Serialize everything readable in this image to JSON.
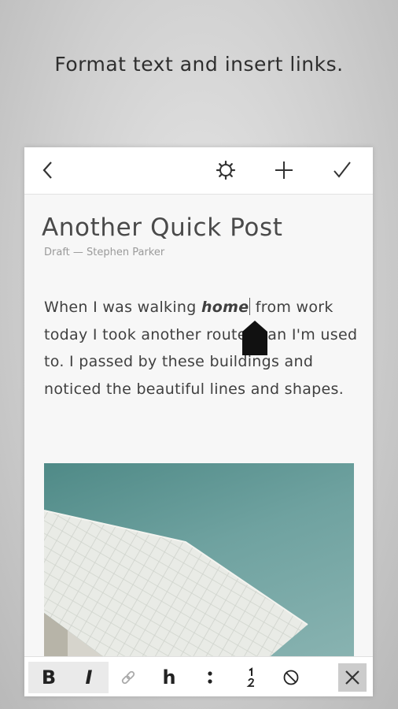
{
  "caption": "Format text and insert links.",
  "post": {
    "title": "Another Quick Post",
    "meta": "Draft — Stephen Parker",
    "body_before": "When I was walking ",
    "body_emphasis": "home",
    "body_after": " from work today I took another route than I'm used to. I passed by these buildings and noticed the beautiful lines and shapes."
  },
  "toolbar": {
    "bold_label": "B",
    "italic_label": "I",
    "heading_label": "h"
  },
  "icons": {
    "back": "chevron-left-icon",
    "settings": "gear-icon",
    "add": "plus-icon",
    "done": "checkmark-icon",
    "link": "link-icon",
    "bullet_list": "bullet-list-icon",
    "numbered_list": "numbered-list-icon",
    "clear_format": "clear-formatting-icon",
    "close": "close-icon"
  },
  "colors": {
    "accent": "#4f8a87",
    "text": "#404040"
  }
}
